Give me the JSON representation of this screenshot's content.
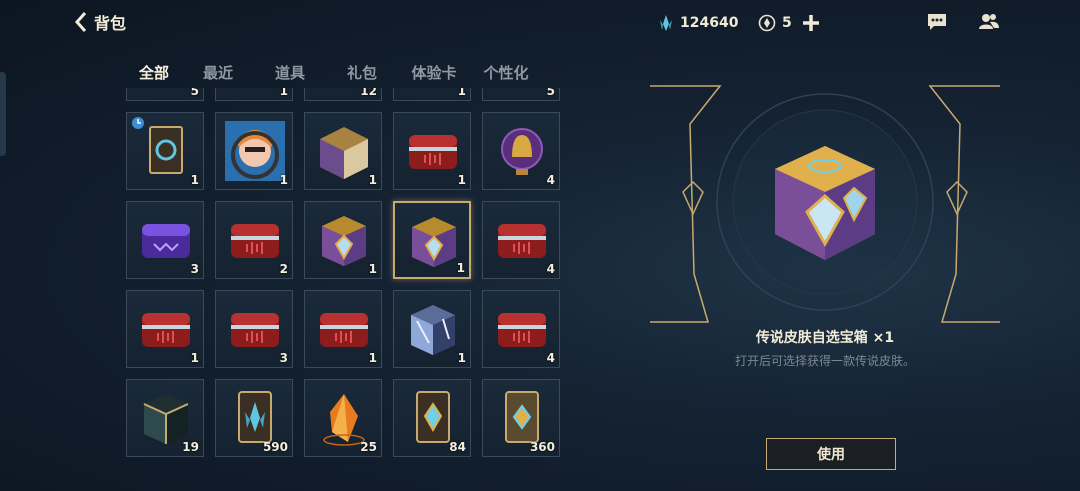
{
  "header": {
    "title": "背包"
  },
  "currency": {
    "blue_essence": "124640",
    "tokens": "5"
  },
  "tabs": [
    "全部",
    "最近",
    "道具",
    "礼包",
    "体验卡",
    "个性化"
  ],
  "grid": {
    "top_row_counts": [
      "5",
      "1",
      "12",
      "1",
      "5"
    ],
    "rows": [
      [
        {
          "icon": "skin-card-icon",
          "count": "1",
          "timed": true
        },
        {
          "icon": "champion-portrait-icon",
          "count": "1"
        },
        {
          "icon": "gold-chest-icon",
          "count": "1"
        },
        {
          "icon": "red-chest-icon",
          "count": "1"
        },
        {
          "icon": "helmet-emblem-icon",
          "count": "4"
        }
      ],
      [
        {
          "icon": "purple-chest-icon",
          "count": "3"
        },
        {
          "icon": "red-chest-icon",
          "count": "2"
        },
        {
          "icon": "legend-chest-icon",
          "count": "1"
        },
        {
          "icon": "legend-chest-icon",
          "count": "1",
          "selected": true
        },
        {
          "icon": "red-chest-icon",
          "count": "4"
        }
      ],
      [
        {
          "icon": "red-chest-icon",
          "count": "1"
        },
        {
          "icon": "red-chest-icon",
          "count": "3"
        },
        {
          "icon": "red-chest-icon",
          "count": "1"
        },
        {
          "icon": "crystal-cube-icon",
          "count": "1"
        },
        {
          "icon": "red-chest-icon",
          "count": "4"
        }
      ],
      [
        {
          "icon": "dark-cube-icon",
          "count": "19"
        },
        {
          "icon": "blue-essence-card-icon",
          "count": "590"
        },
        {
          "icon": "orange-shard-icon",
          "count": "25"
        },
        {
          "icon": "gem-card-icon",
          "count": "84"
        },
        {
          "icon": "gold-gem-card-icon",
          "count": "360"
        }
      ]
    ]
  },
  "detail": {
    "name": "传说皮肤自选宝箱 ×1",
    "description": "打开后可选择获得一款传说皮肤。",
    "use_label": "使用"
  },
  "colors": {
    "accent_gold": "#c8aa6e",
    "background": "#142232"
  }
}
